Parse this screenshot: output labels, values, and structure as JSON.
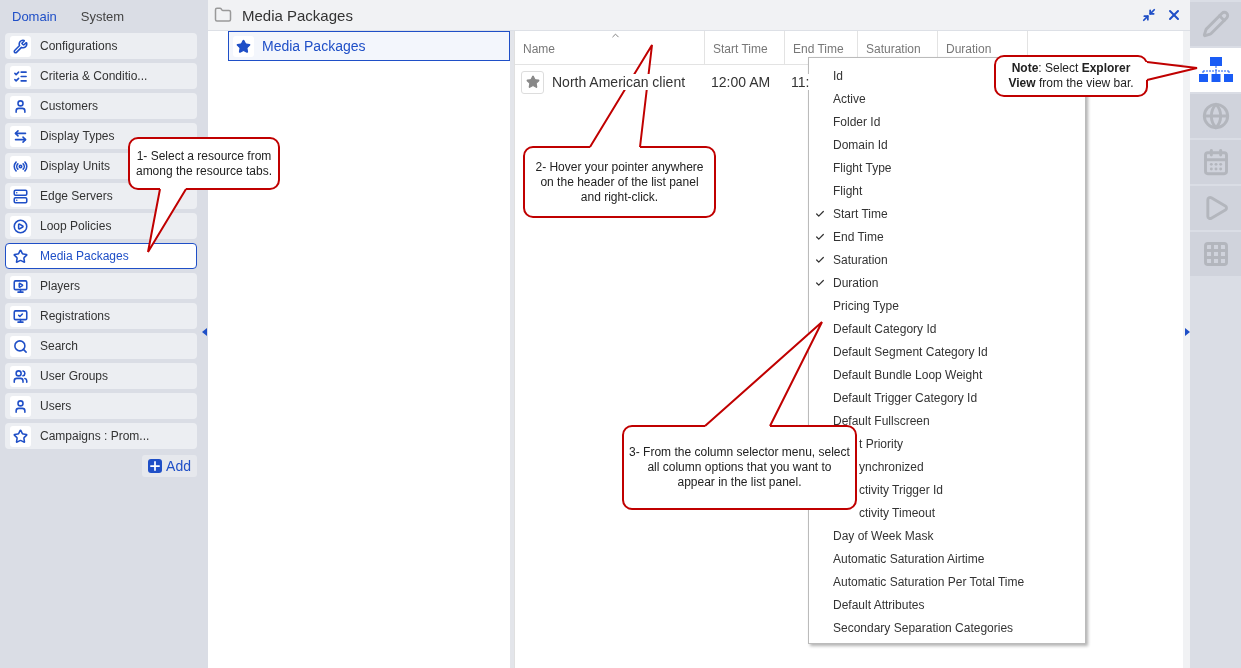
{
  "tabs": [
    {
      "label": "Domain",
      "selected": true
    },
    {
      "label": "System",
      "selected": false
    }
  ],
  "resources": [
    {
      "label": "Configurations",
      "selected": false
    },
    {
      "label": "Criteria & Conditio...",
      "selected": false
    },
    {
      "label": "Customers",
      "selected": false
    },
    {
      "label": "Display Types",
      "selected": false
    },
    {
      "label": "Display Units",
      "selected": false
    },
    {
      "label": "Edge Servers",
      "selected": false
    },
    {
      "label": "Loop Policies",
      "selected": false
    },
    {
      "label": "Media Packages",
      "selected": true
    },
    {
      "label": "Players",
      "selected": false
    },
    {
      "label": "Registrations",
      "selected": false
    },
    {
      "label": "Search",
      "selected": false
    },
    {
      "label": "User Groups",
      "selected": false
    },
    {
      "label": "Users",
      "selected": false
    },
    {
      "label": "Campaigns : Prom...",
      "selected": false
    }
  ],
  "add_button": "Add",
  "panel": {
    "title": "Media Packages"
  },
  "tree": [
    {
      "label": "Media Packages",
      "selected": true
    }
  ],
  "list": {
    "columns": [
      {
        "label": "Name",
        "sorted": true
      },
      {
        "label": "Start Time",
        "sorted": false
      },
      {
        "label": "End Time",
        "sorted": false
      },
      {
        "label": "Saturation",
        "sorted": false
      },
      {
        "label": "Duration",
        "sorted": false
      }
    ],
    "rows": [
      {
        "cells": [
          "North American client",
          "12:00 AM",
          "11:"
        ]
      }
    ]
  },
  "column_menu": [
    {
      "label": "Id",
      "checked": false,
      "partly_hidden": false
    },
    {
      "label": "Active",
      "checked": false,
      "partly_hidden": false
    },
    {
      "label": "Folder Id",
      "checked": false,
      "partly_hidden": false
    },
    {
      "label": "Domain Id",
      "checked": false,
      "partly_hidden": false
    },
    {
      "label": "Flight Type",
      "checked": false,
      "partly_hidden": false
    },
    {
      "label": "Flight",
      "checked": false,
      "partly_hidden": false
    },
    {
      "label": "Start Time",
      "checked": true,
      "partly_hidden": false
    },
    {
      "label": "End Time",
      "checked": true,
      "partly_hidden": false
    },
    {
      "label": "Saturation",
      "checked": true,
      "partly_hidden": false
    },
    {
      "label": "Duration",
      "checked": true,
      "partly_hidden": false
    },
    {
      "label": "Pricing Type",
      "checked": false,
      "partly_hidden": false
    },
    {
      "label": "Default Category Id",
      "checked": false,
      "partly_hidden": false
    },
    {
      "label": "Default Segment Category Id",
      "checked": false,
      "partly_hidden": false
    },
    {
      "label": "Default Bundle Loop Weight",
      "checked": false,
      "partly_hidden": false
    },
    {
      "label": "Default Trigger Category Id",
      "checked": false,
      "partly_hidden": false
    },
    {
      "label": "Default Fullscreen",
      "checked": false,
      "partly_hidden": false
    },
    {
      "label": "t Priority",
      "partly_hidden": true
    },
    {
      "label": "ynchronized",
      "partly_hidden": true
    },
    {
      "label": "ctivity Trigger Id",
      "partly_hidden": true
    },
    {
      "label": "ctivity Timeout",
      "partly_hidden": true
    },
    {
      "label": "Day of Week Mask",
      "checked": false,
      "partly_hidden": false
    },
    {
      "label": "Automatic Saturation Airtime",
      "checked": false,
      "partly_hidden": false
    },
    {
      "label": "Automatic Saturation Per Total Time",
      "checked": false,
      "partly_hidden": false
    },
    {
      "label": "Default Attributes",
      "checked": false,
      "partly_hidden": false
    },
    {
      "label": "Secondary Separation Categories",
      "checked": false,
      "partly_hidden": false
    }
  ],
  "callouts": [
    {
      "text": "1- Select a resource from among the resource tabs."
    },
    {
      "text": "2- Hover your pointer anywhere on the header of the list panel and right-click."
    },
    {
      "text": "3- From the column selector menu, select all column options that you want to appear in the list panel."
    },
    {
      "text": "**Note**: Select **Explorer View** from the view bar."
    }
  ],
  "view_bar": [
    {
      "selected": false
    },
    {
      "selected": true
    },
    {
      "selected": false
    },
    {
      "selected": false
    },
    {
      "selected": false
    },
    {
      "selected": false
    }
  ]
}
